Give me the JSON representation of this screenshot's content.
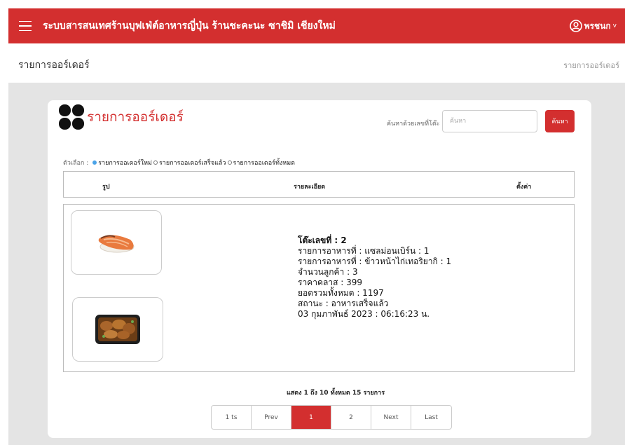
{
  "header": {
    "app_title": "ระบบสารสนเทศร้านบุฟเฟ่ต์อาหารญี่ปุ่น ร้านชะคะนะ ซาชิมิ เชียงใหม่",
    "user_name": "พรชนก",
    "user_chevron": "v"
  },
  "page": {
    "title": "รายการออร์เดอร์",
    "breadcrumb": "รายการออร์เดอร์"
  },
  "card": {
    "title": "รายการออร์เดอร์",
    "search_label": "ค้นหาด้วยเลขที่โต๊ะ",
    "search_placeholder": "ค้นหา",
    "search_button": "ค้นหา"
  },
  "filters": {
    "label": "ตัวเลือก :",
    "options": [
      {
        "label": "รายการออเดอร์ใหม่",
        "selected": true
      },
      {
        "label": "รายการออเดอร์เสร็จแล้ว",
        "selected": false
      },
      {
        "label": "รายการออเดอร์ทั้งหมด",
        "selected": false
      }
    ]
  },
  "table": {
    "columns": [
      "รูป",
      "รายละเอียด",
      "ตั้งค่า"
    ],
    "rows": [
      {
        "images": [
          "salmon-nigiri",
          "chicken-teriyaki-rice"
        ],
        "details": [
          "โต๊ะเลขที่ : 2",
          "รายการอาหารที่ : แซลม่อนเบิร์น : 1",
          "รายการอาหารที่ : ข้าวหน้าไก่เทอริยากิ : 1",
          "จำนวนลูกค้า : 3",
          "ราคาคลาส : 399",
          "ยอดรวมทั้งหมด : 1197",
          "สถานะ : อาหารเสร็จแล้ว",
          "03 กุมภาพันธ์ 2023 : 06:16:23 น."
        ]
      }
    ]
  },
  "pagination": {
    "info": "แสดง 1 ถึง 10 ทั้งหมด 15 รายการ",
    "buttons": [
      "1 ts",
      "Prev",
      "1",
      "2",
      "Next",
      "Last"
    ],
    "active": "1"
  },
  "colors": {
    "primary": "#d32f2f",
    "radio_selected": "#4aa3e8",
    "background": "#e4e4e4"
  }
}
